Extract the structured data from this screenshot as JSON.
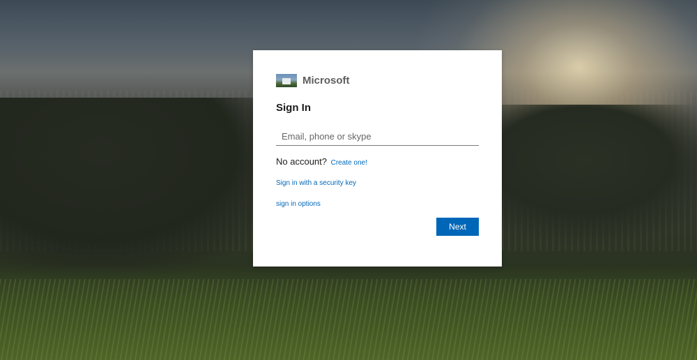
{
  "colors": {
    "accent": "#0067b8",
    "card_background": "#ffffff"
  },
  "brand": {
    "logo_icon": "microsoft-logo-image",
    "name": "Microsoft"
  },
  "signin": {
    "title": "Sign In",
    "email_placeholder": "Email, phone or skype",
    "email_value": "",
    "no_account_text": "No account?",
    "create_link": "Create one!",
    "security_key_link": "Sign in with a security key",
    "options_link": "sign in options",
    "next_button": "Next"
  }
}
